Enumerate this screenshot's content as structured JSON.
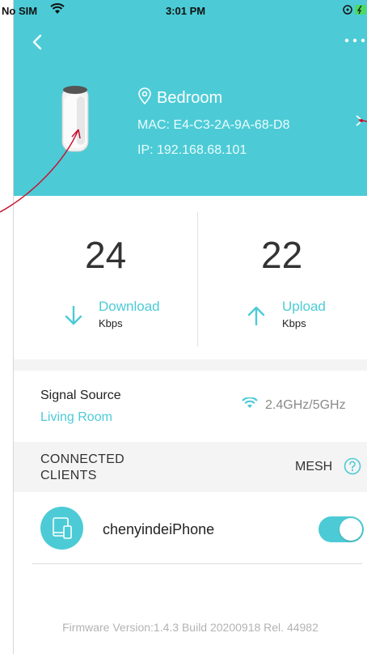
{
  "status_bar": {
    "carrier": "No SIM",
    "time": "3:01 PM"
  },
  "device": {
    "name": "Bedroom",
    "mac": "MAC: E4-C3-2A-9A-68-D8",
    "ip": "IP: 192.168.68.101"
  },
  "speed": {
    "download_value": "24",
    "download_label": "Download",
    "download_unit": "Kbps",
    "upload_value": "22",
    "upload_label": "Upload",
    "upload_unit": "Kbps"
  },
  "signal": {
    "title": "Signal Source",
    "source": "Living Room",
    "band": "2.4GHz/5GHz"
  },
  "clients": {
    "title_line1": "CONNECTED",
    "title_line2": "CLIENTS",
    "mesh_label": "MESH",
    "items": [
      {
        "name": "chenyindeiPhone",
        "enabled": true
      }
    ]
  },
  "footer": {
    "firmware": "Firmware Version:1.4.3 Build 20200918 Rel. 44982"
  },
  "colors": {
    "accent": "#4ccbd6",
    "annotation": "#c8102e"
  }
}
